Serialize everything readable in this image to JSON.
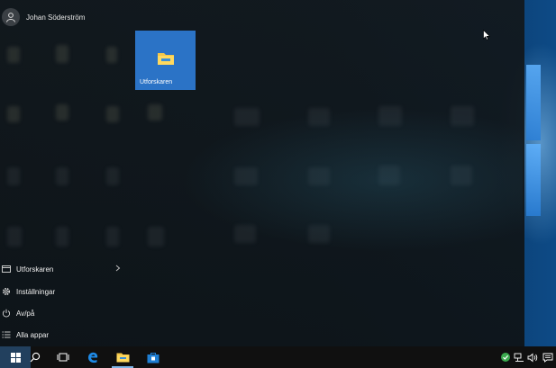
{
  "user": {
    "name": "Johan Söderström"
  },
  "tiles": [
    {
      "label": "Utforskaren",
      "icon": "folder-icon"
    }
  ],
  "menu": {
    "items": [
      {
        "label": "Utforskaren",
        "icon": "file-explorer-icon",
        "has_submenu": true
      },
      {
        "label": "Inställningar",
        "icon": "gear-icon"
      },
      {
        "label": "Av/på",
        "icon": "power-icon"
      },
      {
        "label": "Alla appar",
        "icon": "list-icon"
      }
    ]
  },
  "taskbar": {
    "buttons": [
      "windows-start-icon",
      "search-icon",
      "task-view-icon",
      "edge-icon",
      "file-explorer-icon",
      "store-icon"
    ],
    "tray": [
      "network-status-icon",
      "network-icon",
      "volume-icon",
      "action-center-icon"
    ]
  },
  "colors": {
    "tile": "#2b73c6",
    "taskbar": "#101010",
    "start_button": "#22405e",
    "accent_underline": "#7db5e8"
  }
}
